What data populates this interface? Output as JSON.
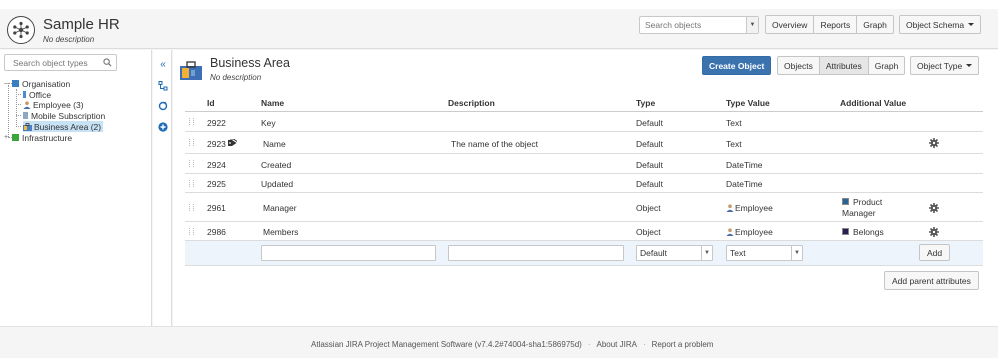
{
  "header": {
    "app_title": "Sample HR",
    "app_description": "No description",
    "search_placeholder": "Search objects",
    "nav": [
      "Overview",
      "Reports",
      "Graph"
    ],
    "object_schema_label": "Object Schema"
  },
  "sidebar": {
    "search_placeholder": "Search object types",
    "tree": {
      "organisation": "Organisation",
      "office": "Office",
      "employee": "Employee (3)",
      "mobile_subscription": "Mobile Subscription",
      "business_area": "Business Area (2)",
      "infrastructure": "Infrastructure"
    }
  },
  "object_type": {
    "title": "Business Area",
    "description": "No description",
    "create_label": "Create Object",
    "tabs": [
      "Objects",
      "Attributes",
      "Graph"
    ],
    "active_tab": "Attributes",
    "object_type_label": "Object Type"
  },
  "table": {
    "headers": {
      "id": "Id",
      "name": "Name",
      "description": "Description",
      "type": "Type",
      "type_value": "Type Value",
      "additional_value": "Additional Value"
    },
    "rows": [
      {
        "id": "2922",
        "name": "Key",
        "description": "",
        "type": "Default",
        "type_value": "Text",
        "additional": ""
      },
      {
        "id": "2923",
        "name": "Name",
        "description": "The name of the object",
        "type": "Default",
        "type_value": "Text",
        "additional": ""
      },
      {
        "id": "2924",
        "name": "Created",
        "description": "",
        "type": "Default",
        "type_value": "DateTime",
        "additional": ""
      },
      {
        "id": "2925",
        "name": "Updated",
        "description": "",
        "type": "Default",
        "type_value": "DateTime",
        "additional": ""
      },
      {
        "id": "2961",
        "name": "Manager",
        "description": "",
        "type": "Object",
        "type_value": "Employee",
        "additional_line1": "Product",
        "additional_line2": "Manager",
        "swatch_color": "#2a6496"
      },
      {
        "id": "2986",
        "name": "Members",
        "description": "",
        "type": "Object",
        "type_value": "Employee",
        "additional": "Belongs",
        "swatch_color": "#2b1d4f"
      }
    ]
  },
  "add_row": {
    "type_selected": "Default",
    "type_value_selected": "Text",
    "add_label": "Add"
  },
  "add_parent_label": "Add parent attributes",
  "footer": {
    "software": "Atlassian JIRA Project Management Software (v7.4.2#74004-sha1:586975d)",
    "about": "About JIRA",
    "report": "Report a problem"
  }
}
